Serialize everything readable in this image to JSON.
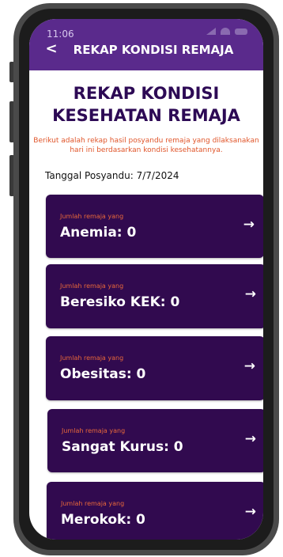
{
  "status_bar": {
    "time": "11:06",
    "signal_icon": "signal-icon",
    "wifi_icon": "wifi-icon",
    "battery_icon": "battery-icon"
  },
  "app_bar": {
    "back_icon": "back-chevron-icon",
    "back_glyph": "<",
    "title": "REKAP KONDISI REMAJA",
    "background_color": "#5a2a8c"
  },
  "main": {
    "heading_line1": "REKAP KONDISI",
    "heading_line2": "KESEHATAN REMAJA",
    "subtitle": "Berikut adalah rekap hasil posyandu remaja yang dilaksanakan hari ini berdasarkan kondisi kesehatannya.",
    "date_text": "Tanggal Posyandu: 7/7/2024"
  },
  "cards": [
    {
      "label": "Jumlah remaja yang",
      "value": "Anemia: 0",
      "arrow_icon": "arrow-right-icon",
      "arrow": "→"
    },
    {
      "label": "Jumlah remaja yang",
      "value": "Beresiko KEK: 0",
      "arrow_icon": "arrow-right-icon",
      "arrow": "→"
    },
    {
      "label": "Jumlah remaja yang",
      "value": "Obesitas: 0",
      "arrow_icon": "arrow-right-icon",
      "arrow": "→"
    },
    {
      "label": "Jumlah remaja yang",
      "value": "Sangat Kurus: 0",
      "arrow_icon": "arrow-right-icon",
      "arrow": "→"
    },
    {
      "label": "Jumlah remaja yang",
      "value": "Merokok: 0",
      "arrow_icon": "arrow-right-icon",
      "arrow": "→"
    }
  ],
  "colors": {
    "app_bar": "#5a2a8c",
    "card": "#310a4f",
    "heading": "#2d0a55",
    "accent_orange": "#e0552a"
  }
}
